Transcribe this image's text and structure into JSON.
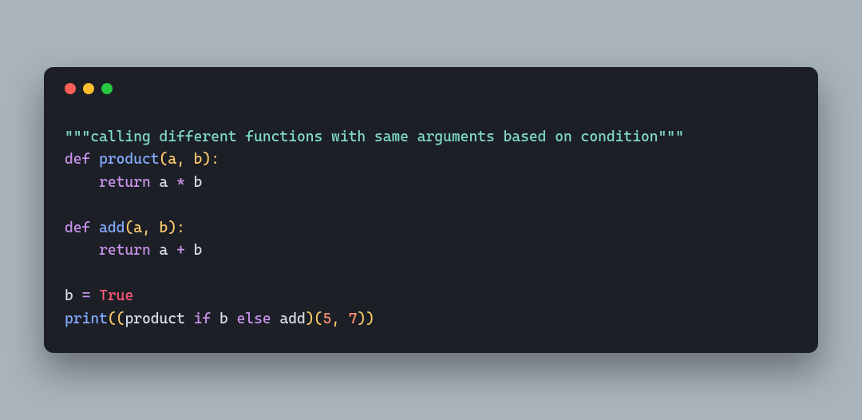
{
  "window": {
    "traffic_lights": [
      "red",
      "yellow",
      "green"
    ]
  },
  "code": {
    "l1_docstring": "\"\"\"calling different functions with same arguments based on condition\"\"\"",
    "l2_def": "def",
    "l2_fn": "product",
    "l2_params": "(a, b):",
    "l3_indent": "    ",
    "l3_return": "return",
    "l3_sp1": " a ",
    "l3_op": "*",
    "l3_sp2": " b",
    "l5_def": "def",
    "l5_fn": "add",
    "l5_params": "(a, b):",
    "l6_indent": "    ",
    "l6_return": "return",
    "l6_sp1": " a ",
    "l6_op": "+",
    "l6_sp2": " b",
    "l8_var": "b ",
    "l8_eq": "=",
    "l8_sp": " ",
    "l8_val": "True",
    "l9_print": "print",
    "l9_p1": "((",
    "l9_prod": "product ",
    "l9_if": "if",
    "l9_b": " b ",
    "l9_else": "else",
    "l9_add": " add",
    "l9_p2": ")(",
    "l9_n1": "5",
    "l9_comma": ", ",
    "l9_n2": "7",
    "l9_p3": "))"
  }
}
